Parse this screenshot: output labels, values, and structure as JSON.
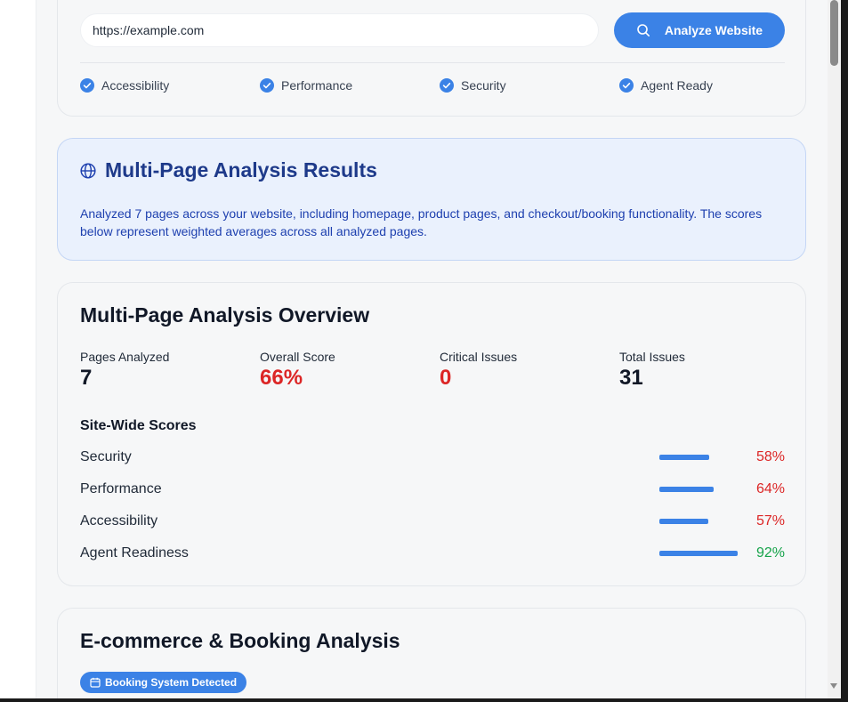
{
  "url_form": {
    "url_value": "https://example.com",
    "analyze_label": "Analyze Website",
    "checks": [
      {
        "label": "Accessibility",
        "icon": "check-circle-icon"
      },
      {
        "label": "Performance",
        "icon": "check-circle-icon"
      },
      {
        "label": "Security",
        "icon": "check-circle-icon"
      },
      {
        "label": "Agent Ready",
        "icon": "check-circle-icon"
      }
    ]
  },
  "results": {
    "title": "Multi-Page Analysis Results",
    "icon": "globe-icon",
    "description": "Analyzed 7 pages across your website, including homepage, product pages, and checkout/booking functionality. The scores below represent weighted averages across all analyzed pages."
  },
  "overview": {
    "title": "Multi-Page Analysis Overview",
    "stats": [
      {
        "label": "Pages Analyzed",
        "value": "7",
        "color": "#111827"
      },
      {
        "label": "Overall Score",
        "value": "66%",
        "color": "#dc2626"
      },
      {
        "label": "Critical Issues",
        "value": "0",
        "color": "#dc2626"
      },
      {
        "label": "Total Issues",
        "value": "31",
        "color": "#111827"
      }
    ],
    "site_wide_title": "Site-Wide Scores",
    "scores": [
      {
        "name": "Security",
        "percent": "58%",
        "value": 58,
        "color": "#dc2626"
      },
      {
        "name": "Performance",
        "percent": "64%",
        "value": 64,
        "color": "#dc2626"
      },
      {
        "name": "Accessibility",
        "percent": "57%",
        "value": 57,
        "color": "#dc2626"
      },
      {
        "name": "Agent Readiness",
        "percent": "92%",
        "value": 92,
        "color": "#16a34a"
      }
    ]
  },
  "ecommerce": {
    "title": "E-commerce & Booking Analysis",
    "badge": "Booking System Detected",
    "badge_icon": "calendar-icon"
  },
  "colors": {
    "accent": "#3b82e6",
    "danger": "#dc2626",
    "success": "#16a34a"
  }
}
